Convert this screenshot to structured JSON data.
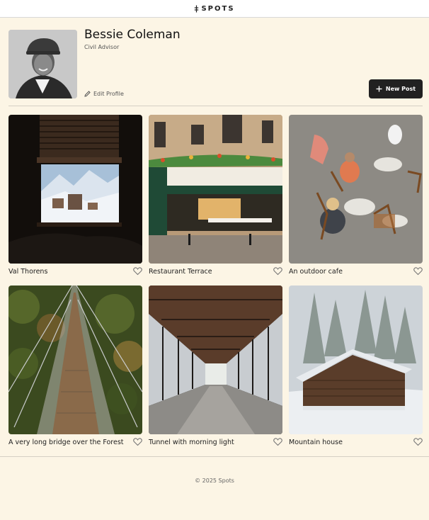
{
  "header": {
    "logo_text": "SPOTS",
    "logo_icon": "spots-logo-icon"
  },
  "profile": {
    "name": "Bessie Coleman",
    "role": "Civil Advisor",
    "edit_label": "Edit Profile",
    "new_post_label": "New Post",
    "icons": {
      "edit": "pencil-icon",
      "new_post": "plus-icon"
    }
  },
  "cards": [
    {
      "title": "Val Thorens",
      "liked": false
    },
    {
      "title": "Restaurant Terrace",
      "liked": false
    },
    {
      "title": "An outdoor cafe",
      "liked": false
    },
    {
      "title": "A very long bridge over the Forest",
      "liked": false
    },
    {
      "title": "Tunnel with morning light",
      "liked": false
    },
    {
      "title": "Mountain house",
      "liked": false
    }
  ],
  "footer": {
    "copyright": "© 2025 Spots"
  },
  "colors": {
    "background": "#fcf5e5",
    "button": "#212121",
    "text": "#212121"
  }
}
